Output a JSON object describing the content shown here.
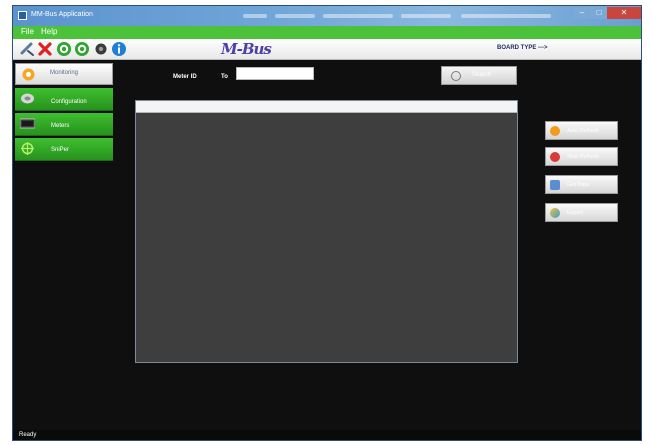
{
  "window": {
    "title": "MM-Bus Application"
  },
  "menu": {
    "items": [
      "File",
      "Help"
    ]
  },
  "toolbar": {
    "icons": [
      "connect-icon",
      "disconnect-icon",
      "start-icon",
      "refresh-icon",
      "camera-icon",
      "info-icon"
    ],
    "brand": "M-Bus",
    "board_type_label": "BOARD TYPE --->"
  },
  "sidebar": {
    "items": [
      {
        "label": "Monitoring",
        "icon": "monitoring-icon",
        "active": true
      },
      {
        "label": "Configuration",
        "icon": "configuration-icon",
        "active": false
      },
      {
        "label": "Meters",
        "icon": "meters-icon",
        "active": false
      },
      {
        "label": "SniPer",
        "icon": "sniper-icon",
        "active": false
      }
    ]
  },
  "filter": {
    "meter_id_label": "Meter ID",
    "to_label": "To",
    "meter_input_value": "",
    "search_label": "Search"
  },
  "actions": {
    "auto_refresh": "Auto Refresh",
    "stop_refresh": "Stop Refresh",
    "get_data": "Get Data",
    "export": "Export"
  },
  "status": {
    "text": "Ready"
  },
  "colors": {
    "menubar": "#4cc23a",
    "sidebar_green": "#2fa524",
    "titlebar": "#6fa5d8",
    "background": "#0f0f0f",
    "grid": "#3e3e3e"
  }
}
